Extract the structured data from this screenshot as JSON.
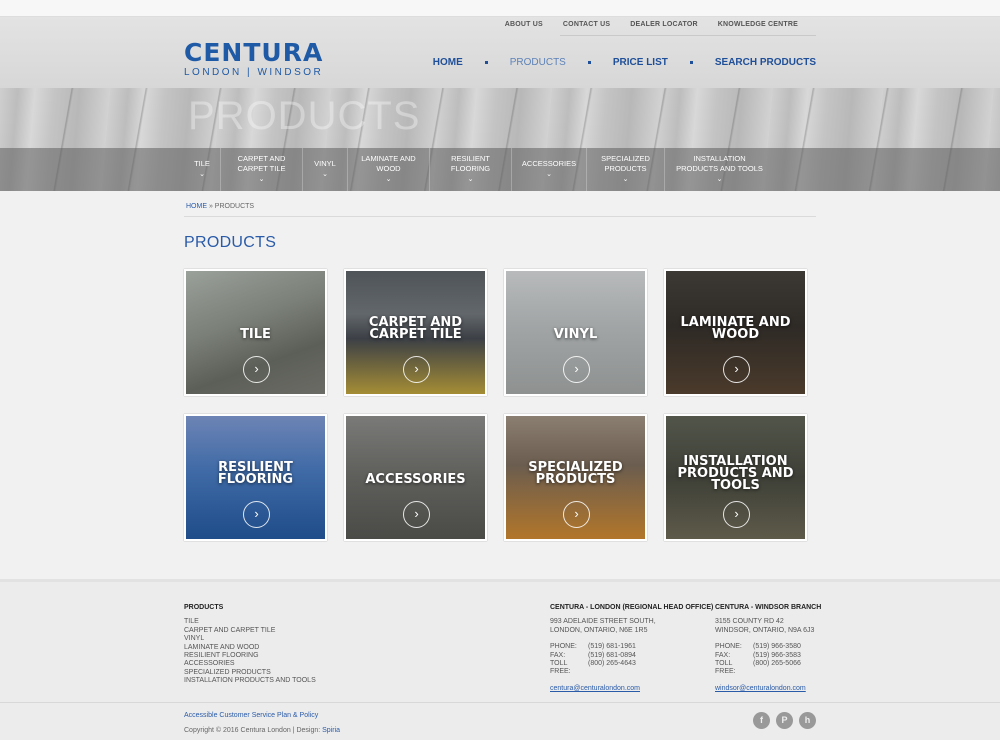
{
  "utility_nav": [
    "ABOUT US",
    "CONTACT US",
    "DEALER LOCATOR",
    "KNOWLEDGE CENTRE"
  ],
  "logo": {
    "name": "CENTURA",
    "sub": "LONDON | WINDSOR"
  },
  "main_nav": [
    "HOME",
    "PRODUCTS",
    "PRICE LIST",
    "SEARCH PRODUCTS"
  ],
  "hero_title": "PRODUCTS",
  "categories": [
    {
      "l1": "TILE",
      "l2": ""
    },
    {
      "l1": "CARPET AND",
      "l2": "CARPET TILE"
    },
    {
      "l1": "VINYL",
      "l2": ""
    },
    {
      "l1": "LAMINATE AND",
      "l2": "WOOD"
    },
    {
      "l1": "RESILIENT",
      "l2": "FLOORING"
    },
    {
      "l1": "ACCESSORIES",
      "l2": ""
    },
    {
      "l1": "SPECIALIZED",
      "l2": "PRODUCTS"
    },
    {
      "l1": "INSTALLATION",
      "l2": "PRODUCTS AND TOOLS"
    }
  ],
  "breadcrumb": {
    "home": "HOME",
    "sep": " » ",
    "current": "PRODUCTS"
  },
  "page_title": "PRODUCTS",
  "tiles": [
    {
      "l1": "TILE",
      "l2": "",
      "l3": ""
    },
    {
      "l1": "CARPET AND",
      "l2": "CARPET TILE",
      "l3": ""
    },
    {
      "l1": "VINYL",
      "l2": "",
      "l3": ""
    },
    {
      "l1": "LAMINATE AND",
      "l2": "WOOD",
      "l3": ""
    },
    {
      "l1": "RESILIENT",
      "l2": "FLOORING",
      "l3": ""
    },
    {
      "l1": "ACCESSORIES",
      "l2": "",
      "l3": ""
    },
    {
      "l1": "SPECIALIZED",
      "l2": "PRODUCTS",
      "l3": ""
    },
    {
      "l1": "INSTALLATION",
      "l2": "PRODUCTS AND",
      "l3": "TOOLS"
    }
  ],
  "footer": {
    "products_heading": "PRODUCTS",
    "products": [
      "TILE",
      "CARPET AND CARPET TILE",
      "VINYL",
      "LAMINATE AND WOOD",
      "RESILIENT FLOORING",
      "ACCESSORIES",
      "SPECIALIZED PRODUCTS",
      "INSTALLATION PRODUCTS AND TOOLS"
    ],
    "london": {
      "heading": "CENTURA - LONDON (REGIONAL HEAD OFFICE)",
      "address1": "993 ADELAIDE STREET SOUTH,",
      "address2": "LONDON, ONTARIO, N6E 1R5",
      "phone_label": "PHONE:",
      "phone": "(519) 681-1961",
      "fax_label": "FAX:",
      "fax": "(519) 681-0894",
      "tollfree_label": "TOLL FREE:",
      "tollfree": "(800) 265-4643",
      "email": "centura@centuralondon.com"
    },
    "windsor": {
      "heading": "CENTURA - WINDSOR BRANCH",
      "address1": "3155 COUNTY RD 42",
      "address2": "WINDSOR, ONTARIO, N9A 6J3",
      "phone_label": "PHONE:",
      "phone": "(519) 966-3580",
      "fax_label": "FAX:",
      "fax": "(519) 966-3583",
      "tollfree_label": "TOLL FREE:",
      "tollfree": "(800) 265-5066",
      "email": "windsor@centuralondon.com"
    },
    "policy": "Accessible Customer Service Plan & Policy",
    "copyright": "Copyright © 2016 Centura London | Design: ",
    "designer": "Spiria",
    "social": [
      "f",
      "P",
      "h"
    ]
  },
  "social_icons": [
    "facebook-icon",
    "pinterest-icon",
    "houzz-icon"
  ],
  "colors": {
    "brand_blue": "#1f5aa6",
    "link_blue": "#2a5ba8"
  }
}
